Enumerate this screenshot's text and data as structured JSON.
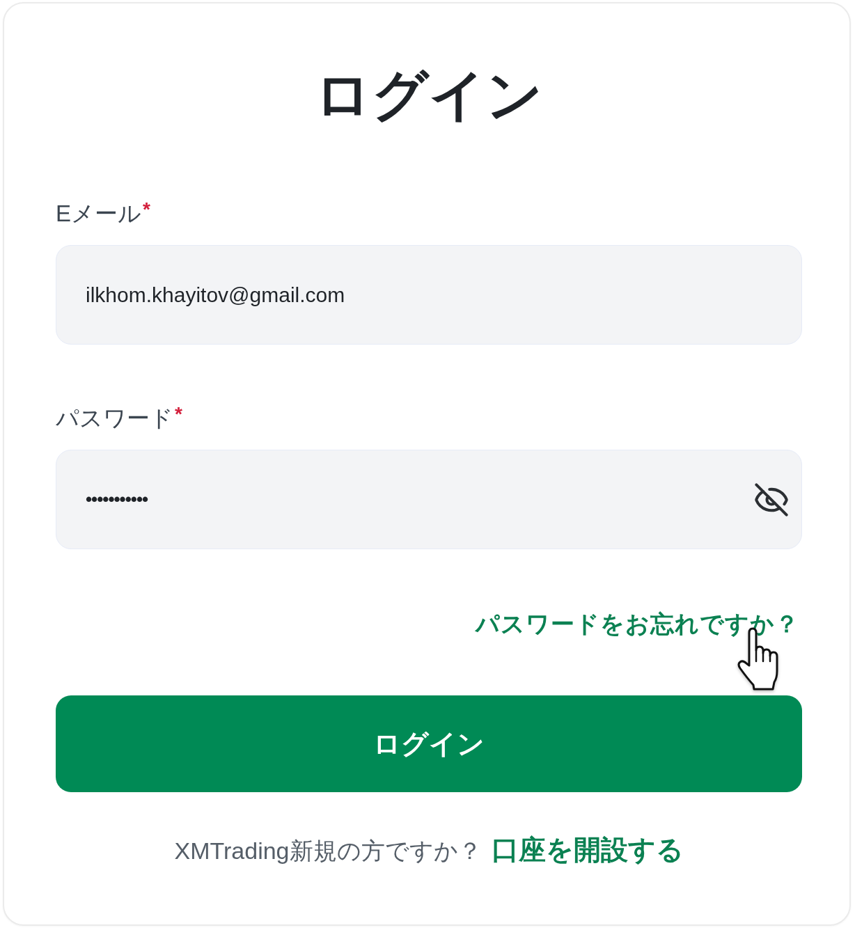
{
  "title": "ログイン",
  "fields": [
    {
      "kind": "email",
      "label": "Eメール",
      "required_mark": "*",
      "value": "ilkhom.khayitov@gmail.com"
    },
    {
      "kind": "password",
      "label": "パスワード",
      "required_mark": "*",
      "value": "•••••••••••",
      "revealed": false
    }
  ],
  "forgot_link": "パスワードをお忘れですか？",
  "submit_button": "ログイン",
  "signup": {
    "prompt": "XMTrading新規の方ですか？",
    "link": "口座を開設する"
  }
}
